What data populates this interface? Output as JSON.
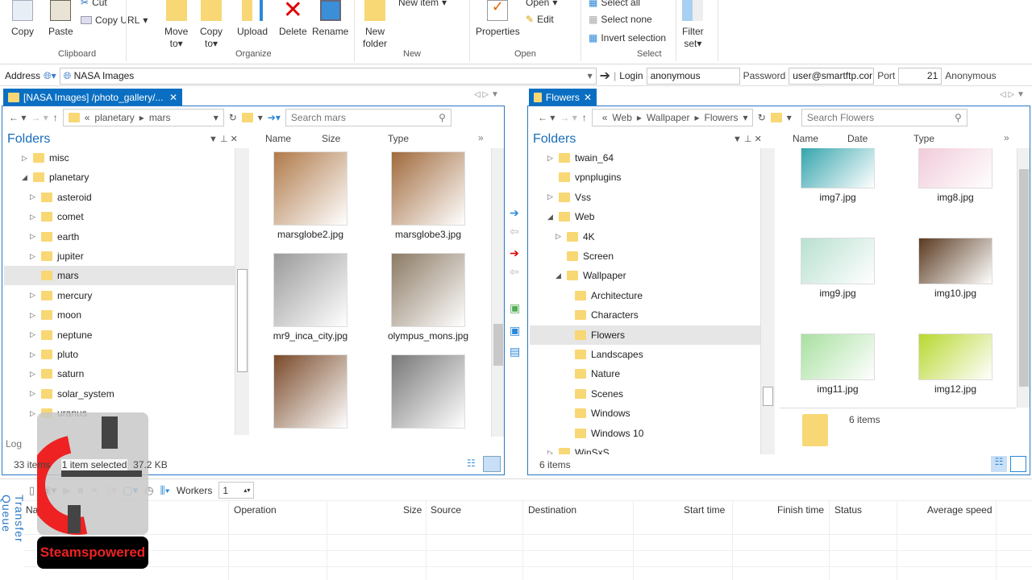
{
  "ribbon": {
    "clipboard": {
      "label": "Clipboard",
      "copy": "Copy",
      "paste": "Paste",
      "cut": "Cut",
      "copy_url": "Copy URL"
    },
    "organize": {
      "label": "Organize",
      "move_to": "Move",
      "move_to2": "to",
      "copy_to": "Copy",
      "copy_to2": "to",
      "upload": "Upload",
      "delete": "Delete",
      "rename": "Rename"
    },
    "new": {
      "label": "New",
      "new_folder": "New",
      "new_folder2": "folder",
      "new_item": "New item"
    },
    "open": {
      "label": "Open",
      "properties": "Properties",
      "open": "Open",
      "edit": "Edit"
    },
    "select": {
      "label": "Select",
      "select_all": "Select all",
      "select_none": "Select none",
      "invert": "Invert selection"
    },
    "filter": {
      "label": "Filter",
      "label2": "set"
    }
  },
  "address": {
    "label": "Address",
    "value": "NASA Images",
    "login_label": "Login",
    "login": "anonymous",
    "password_label": "Password",
    "password": "user@smartftp.cor",
    "port_label": "Port",
    "port": "21",
    "anon": "Anonymous"
  },
  "left": {
    "tab": "[NASA Images] /photo_gallery/...",
    "breadcrumb": [
      "planetary",
      "mars"
    ],
    "search_placeholder": "Search mars",
    "folders_title": "Folders",
    "tree": [
      {
        "label": "misc",
        "level": 1,
        "expander": "collapsed"
      },
      {
        "label": "planetary",
        "level": 1,
        "expander": "expanded"
      },
      {
        "label": "asteroid",
        "level": 2,
        "expander": "collapsed"
      },
      {
        "label": "comet",
        "level": 2,
        "expander": "collapsed"
      },
      {
        "label": "earth",
        "level": 2,
        "expander": "collapsed"
      },
      {
        "label": "jupiter",
        "level": 2,
        "expander": "collapsed"
      },
      {
        "label": "mars",
        "level": 2,
        "expander": "none",
        "selected": true
      },
      {
        "label": "mercury",
        "level": 2,
        "expander": "collapsed"
      },
      {
        "label": "moon",
        "level": 2,
        "expander": "collapsed"
      },
      {
        "label": "neptune",
        "level": 2,
        "expander": "collapsed"
      },
      {
        "label": "pluto",
        "level": 2,
        "expander": "collapsed"
      },
      {
        "label": "saturn",
        "level": 2,
        "expander": "collapsed"
      },
      {
        "label": "solar_system",
        "level": 2,
        "expander": "collapsed"
      },
      {
        "label": "uranus",
        "level": 2,
        "expander": "collapsed"
      }
    ],
    "columns": [
      "Name",
      "Size",
      "Type"
    ],
    "files": [
      {
        "name": "marsglobe2.jpg",
        "color": "#b07a4a"
      },
      {
        "name": "marsglobe3.jpg",
        "color": "#a06a3c"
      },
      {
        "name": "mr9_inca_city.jpg",
        "color": "#9a9a9a"
      },
      {
        "name": "olympus_mons.jpg",
        "color": "#8c7a64"
      },
      {
        "name": "",
        "color": "#7a4a2a"
      },
      {
        "name": "",
        "color": "#777777"
      }
    ],
    "log": "Log",
    "status_count": "33 items",
    "status_selected": "1 item selected",
    "status_size": "37.2 KB"
  },
  "right": {
    "tab": "Flowers",
    "breadcrumb": [
      "Web",
      "Wallpaper",
      "Flowers"
    ],
    "search_placeholder": "Search Flowers",
    "folders_title": "Folders",
    "tree": [
      {
        "label": "twain_64",
        "level": 1,
        "expander": "collapsed"
      },
      {
        "label": "vpnplugins",
        "level": 1,
        "expander": "none"
      },
      {
        "label": "Vss",
        "level": 1,
        "expander": "collapsed"
      },
      {
        "label": "Web",
        "level": 1,
        "expander": "expanded"
      },
      {
        "label": "4K",
        "level": 2,
        "expander": "collapsed"
      },
      {
        "label": "Screen",
        "level": 2,
        "expander": "none"
      },
      {
        "label": "Wallpaper",
        "level": 2,
        "expander": "expanded"
      },
      {
        "label": "Architecture",
        "level": 3,
        "expander": "none"
      },
      {
        "label": "Characters",
        "level": 3,
        "expander": "none"
      },
      {
        "label": "Flowers",
        "level": 3,
        "expander": "none",
        "selected": true
      },
      {
        "label": "Landscapes",
        "level": 3,
        "expander": "none"
      },
      {
        "label": "Nature",
        "level": 3,
        "expander": "none"
      },
      {
        "label": "Scenes",
        "level": 3,
        "expander": "none"
      },
      {
        "label": "Windows",
        "level": 3,
        "expander": "none"
      },
      {
        "label": "Windows 10",
        "level": 3,
        "expander": "none"
      },
      {
        "label": "WinSxS",
        "level": 1,
        "expander": "collapsed"
      }
    ],
    "columns": [
      "Name",
      "Date",
      "Type"
    ],
    "files": [
      {
        "name": "img7.jpg",
        "color": "#2aa0a8"
      },
      {
        "name": "img8.jpg",
        "color": "#f0c8d8"
      },
      {
        "name": "img9.jpg",
        "color": "#b8e0d0"
      },
      {
        "name": "img10.jpg",
        "color": "#5a3a20"
      },
      {
        "name": "img11.jpg",
        "color": "#a8e0a0"
      },
      {
        "name": "img12.jpg",
        "color": "#b8d830"
      }
    ],
    "info_items": "6 items",
    "status_count": "6 items"
  },
  "queue": {
    "title": "Transfer Queue",
    "workers_label": "Workers",
    "workers": "1",
    "columns": [
      "Name",
      "Operation",
      "Size",
      "Source",
      "Destination",
      "Start time",
      "Finish time",
      "Status",
      "Average speed"
    ]
  },
  "watermark": {
    "text": "Steamspowered"
  },
  "colors": {
    "accent": "#0a6fc2",
    "folder": "#f8d775"
  }
}
